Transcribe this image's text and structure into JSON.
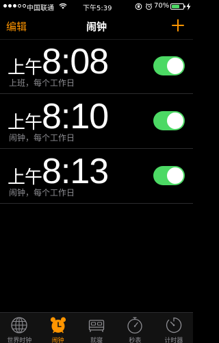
{
  "status": {
    "carrier": "中国联通",
    "time": "下午5:39",
    "battery_pct": "70%",
    "battery_level": 0.7
  },
  "nav": {
    "edit": "编辑",
    "title": "闹钟",
    "add_icon": "plus-icon"
  },
  "alarms": [
    {
      "ampm": "上午",
      "time": "8:08",
      "label": "上班，每个工作日",
      "enabled": true
    },
    {
      "ampm": "上午",
      "time": "8:10",
      "label": "闹钟，每个工作日",
      "enabled": true
    },
    {
      "ampm": "上午",
      "time": "8:13",
      "label": "闹钟，每个工作日",
      "enabled": true
    }
  ],
  "tabs": [
    {
      "label": "世界时钟",
      "icon": "globe-icon",
      "active": false
    },
    {
      "label": "闹钟",
      "icon": "alarm-clock-icon",
      "active": true
    },
    {
      "label": "就寝",
      "icon": "bed-icon",
      "active": false
    },
    {
      "label": "秒表",
      "icon": "stopwatch-icon",
      "active": false
    },
    {
      "label": "计时器",
      "icon": "timer-icon",
      "active": false
    }
  ],
  "colors": {
    "accent": "#ff9500",
    "toggle_on": "#4cd964",
    "secondary_text": "#8e8e93"
  }
}
